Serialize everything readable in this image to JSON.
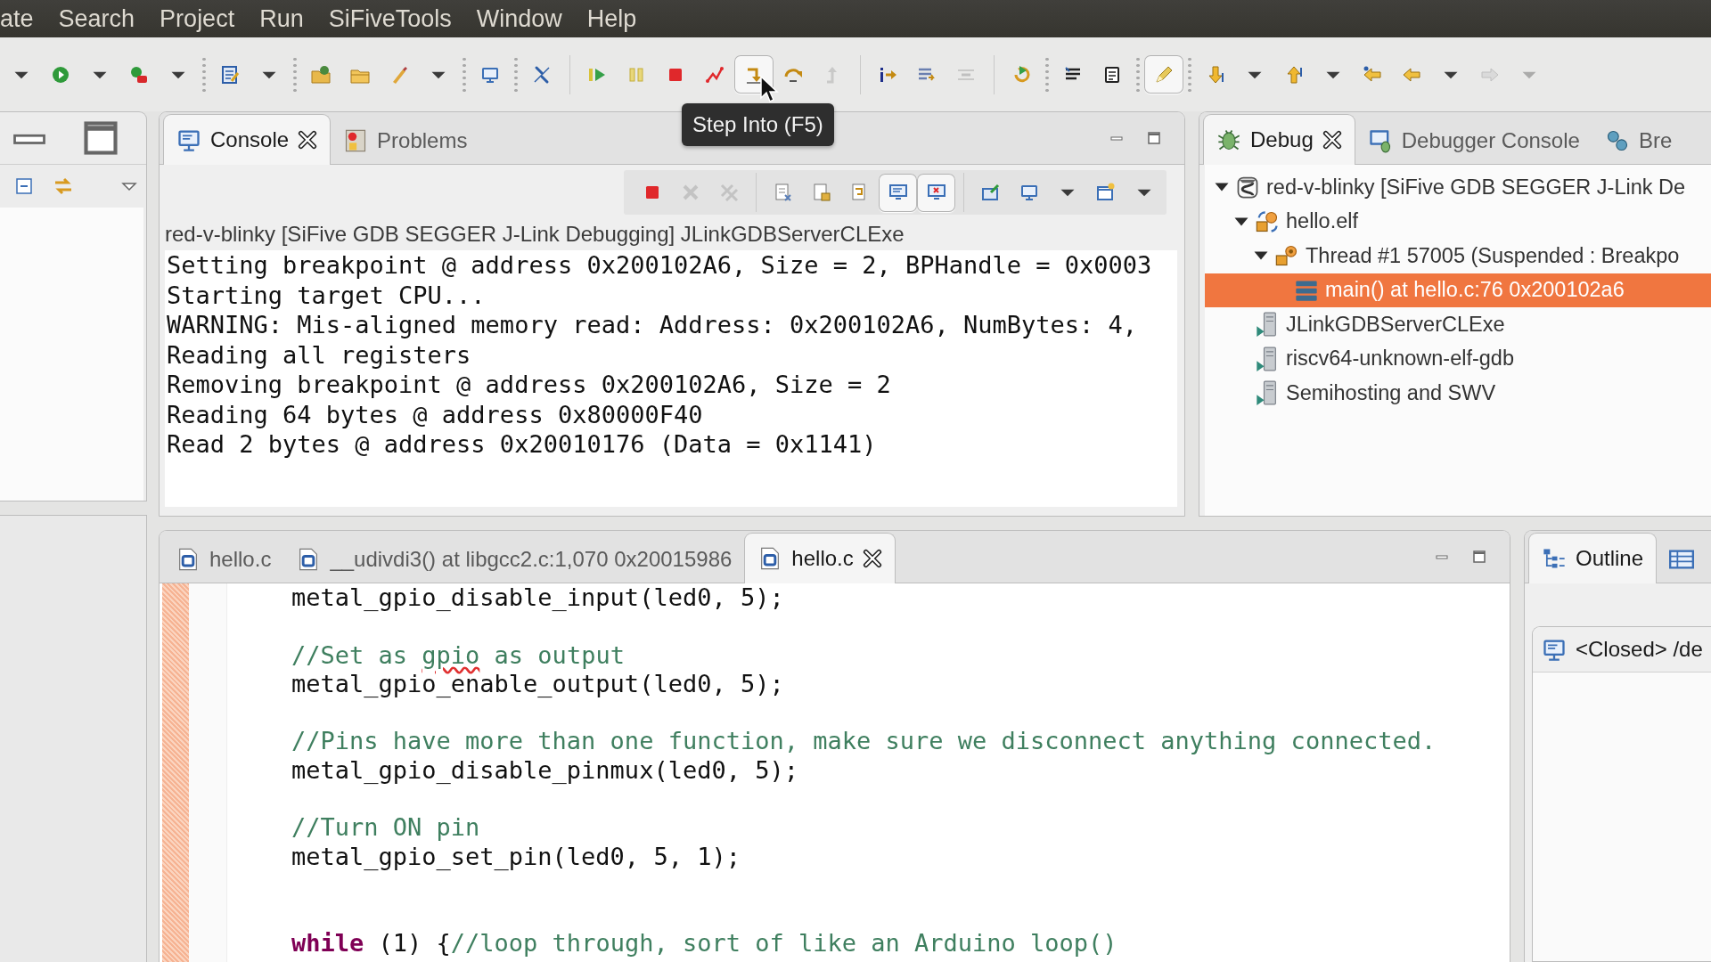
{
  "menu": [
    "ate",
    "Search",
    "Project",
    "Run",
    "SiFiveTools",
    "Window",
    "Help"
  ],
  "toolbar": [
    {
      "kind": "caret",
      "disabled": false,
      "pressed": false
    },
    {
      "kind": "run",
      "disabled": false,
      "pressed": false
    },
    {
      "kind": "caret",
      "disabled": false,
      "pressed": false
    },
    {
      "kind": "launch",
      "disabled": false,
      "pressed": false
    },
    {
      "kind": "caret",
      "disabled": false,
      "pressed": false
    },
    {
      "kind": "dots"
    },
    {
      "kind": "edit",
      "disabled": false,
      "pressed": false
    },
    {
      "kind": "caret",
      "disabled": false,
      "pressed": false
    },
    {
      "kind": "dots"
    },
    {
      "kind": "folder-globe",
      "disabled": false,
      "pressed": false
    },
    {
      "kind": "folder",
      "disabled": false,
      "pressed": false
    },
    {
      "kind": "brush",
      "disabled": false,
      "pressed": false
    },
    {
      "kind": "caret",
      "disabled": false,
      "pressed": false
    },
    {
      "kind": "dots"
    },
    {
      "kind": "monitor",
      "disabled": false,
      "pressed": false
    },
    {
      "kind": "dots"
    },
    {
      "kind": "unlink",
      "disabled": false,
      "pressed": false
    },
    {
      "kind": "line"
    },
    {
      "kind": "resume",
      "disabled": false,
      "pressed": false
    },
    {
      "kind": "suspend",
      "disabled": false,
      "pressed": false
    },
    {
      "kind": "terminate",
      "disabled": false,
      "pressed": false
    },
    {
      "kind": "disconnect",
      "disabled": false,
      "pressed": false
    },
    {
      "kind": "step-into",
      "disabled": false,
      "pressed": true
    },
    {
      "kind": "step-over",
      "disabled": false,
      "pressed": false
    },
    {
      "kind": "step-return",
      "disabled": true,
      "pressed": false
    },
    {
      "kind": "line"
    },
    {
      "kind": "instruction",
      "disabled": false,
      "pressed": false
    },
    {
      "kind": "drop-frame",
      "disabled": false,
      "pressed": false
    },
    {
      "kind": "step-filter",
      "disabled": true,
      "pressed": false
    },
    {
      "kind": "line"
    },
    {
      "kind": "restart",
      "disabled": false,
      "pressed": false
    },
    {
      "kind": "dots"
    },
    {
      "kind": "list",
      "disabled": false,
      "pressed": false
    },
    {
      "kind": "chip",
      "disabled": false,
      "pressed": false
    },
    {
      "kind": "dots"
    },
    {
      "kind": "pencil",
      "disabled": false,
      "pressed": true
    },
    {
      "kind": "dots"
    },
    {
      "kind": "arrow-down",
      "disabled": false,
      "pressed": false
    },
    {
      "kind": "caret",
      "disabled": false,
      "pressed": false
    },
    {
      "kind": "arrow-up",
      "disabled": false,
      "pressed": false
    },
    {
      "kind": "caret",
      "disabled": false,
      "pressed": false
    },
    {
      "kind": "back-star",
      "disabled": false,
      "pressed": false
    },
    {
      "kind": "back",
      "disabled": false,
      "pressed": false
    },
    {
      "kind": "caret",
      "disabled": false,
      "pressed": false
    },
    {
      "kind": "forward",
      "disabled": true,
      "pressed": false
    },
    {
      "kind": "caret",
      "disabled": true,
      "pressed": false
    }
  ],
  "tooltip": {
    "text": "Step Into (F5)"
  },
  "console": {
    "tabs": [
      {
        "label": "Console",
        "kind": "console",
        "selected": true,
        "closable": true
      },
      {
        "label": "Problems",
        "kind": "problems",
        "selected": false,
        "closable": false
      }
    ],
    "toolbar": [
      {
        "kind": "terminate",
        "disabled": false,
        "pressed": false
      },
      {
        "kind": "remove",
        "disabled": true,
        "pressed": false
      },
      {
        "kind": "remove-all",
        "disabled": true,
        "pressed": false
      },
      {
        "kind": "line"
      },
      {
        "kind": "clear",
        "disabled": false,
        "pressed": false
      },
      {
        "kind": "lock",
        "disabled": false,
        "pressed": false
      },
      {
        "kind": "wrap",
        "disabled": false,
        "pressed": false
      },
      {
        "kind": "show-out",
        "disabled": false,
        "pressed": true
      },
      {
        "kind": "show-err",
        "disabled": false,
        "pressed": true
      },
      {
        "kind": "line"
      },
      {
        "kind": "pin",
        "disabled": false,
        "pressed": false
      },
      {
        "kind": "monitor",
        "disabled": false,
        "pressed": false
      },
      {
        "kind": "caret",
        "disabled": false,
        "pressed": false
      },
      {
        "kind": "new-console",
        "disabled": false,
        "pressed": false
      },
      {
        "kind": "caret",
        "disabled": false,
        "pressed": false
      }
    ],
    "process": "red-v-blinky [SiFive GDB SEGGER J-Link Debugging] JLinkGDBServerCLExe",
    "lines": [
      "Setting breakpoint @ address 0x200102A6, Size = 2, BPHandle = 0x0003",
      "Starting target CPU...",
      "WARNING: Mis-aligned memory read: Address: 0x200102A6, NumBytes: 4,",
      "Reading all registers",
      "Removing breakpoint @ address 0x200102A6, Size = 2",
      "Reading 64 bytes @ address 0x80000F40",
      "Read 2 bytes @ address 0x20010176 (Data = 0x1141)"
    ]
  },
  "debug": {
    "tabs": [
      {
        "label": "Debug",
        "kind": "debug",
        "selected": true,
        "closable": true
      },
      {
        "label": "Debugger Console",
        "kind": "debugger-console",
        "selected": false,
        "closable": false
      },
      {
        "label": "Bre",
        "kind": "breakpoints",
        "selected": false,
        "closable": false
      }
    ],
    "tree": [
      {
        "label": "red-v-blinky [SiFive GDB SEGGER J-Link De",
        "kind": "launch",
        "selected": false,
        "expanded": true,
        "children": [
          {
            "label": "hello.elf",
            "kind": "process",
            "selected": false,
            "expanded": true,
            "children": [
              {
                "label": "Thread #1 57005 (Suspended : Breakpo",
                "kind": "thread",
                "selected": false,
                "expanded": true,
                "children": [
                  {
                    "label": "main() at hello.c:76 0x200102a6",
                    "kind": "frame",
                    "selected": true
                  }
                ]
              }
            ]
          },
          {
            "label": "JLinkGDBServerCLExe",
            "kind": "server",
            "selected": false
          },
          {
            "label": "riscv64-unknown-elf-gdb",
            "kind": "server",
            "selected": false
          },
          {
            "label": "Semihosting and SWV",
            "kind": "server",
            "selected": false
          }
        ]
      }
    ]
  },
  "editor": {
    "tabs": [
      {
        "label": "hello.c",
        "kind": "file",
        "selected": false,
        "closable": false
      },
      {
        "label": "__udivdi3() at libgcc2.c:1,070 0x20015986",
        "kind": "file",
        "selected": false,
        "closable": false
      },
      {
        "label": "hello.c",
        "kind": "file",
        "selected": true,
        "closable": true
      }
    ],
    "lines": [
      {
        "kind": "code",
        "segments": [
          {
            "kind": "code",
            "text": "metal_gpio_disable_input(led0, 5);"
          }
        ]
      },
      {
        "kind": "blank"
      },
      {
        "kind": "code",
        "segments": [
          {
            "kind": "comment",
            "text": "//Set as "
          },
          {
            "kind": "misspelled",
            "text": "gpio"
          },
          {
            "kind": "comment",
            "text": " as output"
          }
        ]
      },
      {
        "kind": "code",
        "segments": [
          {
            "kind": "code",
            "text": "metal_gpio_enable_output(led0, 5);"
          }
        ]
      },
      {
        "kind": "blank"
      },
      {
        "kind": "code",
        "segments": [
          {
            "kind": "comment",
            "text": "//Pins have more than one function, make sure we disconnect anything connected."
          }
        ]
      },
      {
        "kind": "code",
        "segments": [
          {
            "kind": "code",
            "text": "metal_gpio_disable_pinmux(led0, 5);"
          }
        ]
      },
      {
        "kind": "blank"
      },
      {
        "kind": "code",
        "segments": [
          {
            "kind": "comment",
            "text": "//Turn ON pin"
          }
        ]
      },
      {
        "kind": "code",
        "segments": [
          {
            "kind": "code",
            "text": "metal_gpio_set_pin(led0, 5, 1);"
          }
        ]
      },
      {
        "kind": "blank"
      },
      {
        "kind": "blank"
      },
      {
        "kind": "code",
        "segments": [
          {
            "kind": "keyword",
            "text": "while"
          },
          {
            "kind": "code",
            "text": " (1) {"
          },
          {
            "kind": "comment",
            "text": "//loop through, sort of like an Arduino loop()"
          }
        ]
      }
    ]
  },
  "outline": {
    "tabs": [
      {
        "label": "Outline",
        "kind": "outline",
        "selected": true,
        "closable": false
      },
      {
        "kind": "quick-outline",
        "selected": false,
        "closable": false
      }
    ],
    "view": {
      "title": "<Closed> /de"
    }
  }
}
